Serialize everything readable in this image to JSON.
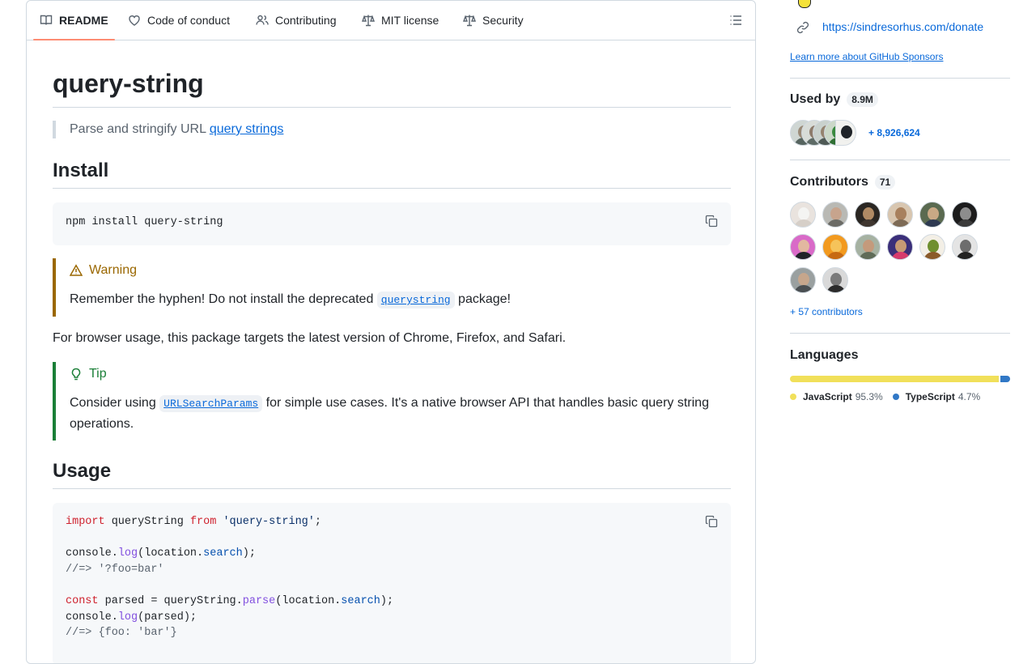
{
  "tabs": [
    {
      "label": "README",
      "icon": "book-icon"
    },
    {
      "label": "Code of conduct",
      "icon": "heart-icon"
    },
    {
      "label": "Contributing",
      "icon": "people-icon"
    },
    {
      "label": "MIT license",
      "icon": "law-icon"
    },
    {
      "label": "Security",
      "icon": "law-icon"
    }
  ],
  "readme": {
    "title": "query-string",
    "tagline_prefix": "Parse and stringify URL ",
    "tagline_link": "query strings",
    "install_heading": "Install",
    "install_cmd": "npm install query-string",
    "warning": {
      "title": "Warning",
      "text_before": "Remember the hyphen! Do not install the deprecated ",
      "code": "querystring",
      "text_after": " package!"
    },
    "browser_para": "For browser usage, this package targets the latest version of Chrome, Firefox, and Safari.",
    "tip": {
      "title": "Tip",
      "text_before": "Consider using ",
      "code": "URLSearchParams",
      "text_after": " for simple use cases. It's a native browser API that handles basic query string operations."
    },
    "usage_heading": "Usage",
    "usage_code": {
      "l1_kw": "import",
      "l1_a": " queryString ",
      "l1_kw2": "from",
      "l1_sp": " ",
      "l1_str": "'query-string'",
      "l1_end": ";",
      "l3_a": "console.",
      "l3_fn": "log",
      "l3_b": "(location.",
      "l3_prop": "search",
      "l3_c": ");",
      "l4": "//=> '?foo=bar'",
      "l6_kw": "const",
      "l6_a": " parsed = queryString.",
      "l6_fn": "parse",
      "l6_b": "(location.",
      "l6_prop": "search",
      "l6_c": ");",
      "l7_a": "console.",
      "l7_fn": "log",
      "l7_b": "(parsed);",
      "l8": "//=> {foo: 'bar'}"
    }
  },
  "sidebar": {
    "donate_url": "https://sindresorhus.com/donate",
    "learn_sponsors": "Learn more about GitHub Sponsors",
    "used_by": {
      "label": "Used by",
      "count": "8.9M",
      "more": "+ 8,926,624"
    },
    "contributors": {
      "label": "Contributors",
      "count": "71",
      "more": "+ 57 contributors"
    },
    "languages": {
      "label": "Languages",
      "items": [
        {
          "name": "JavaScript",
          "percent": "95.3%",
          "share": 95.3,
          "color": "#f1e05a"
        },
        {
          "name": "TypeScript",
          "percent": "4.7%",
          "share": 4.7,
          "color": "#3178c6"
        }
      ]
    }
  }
}
